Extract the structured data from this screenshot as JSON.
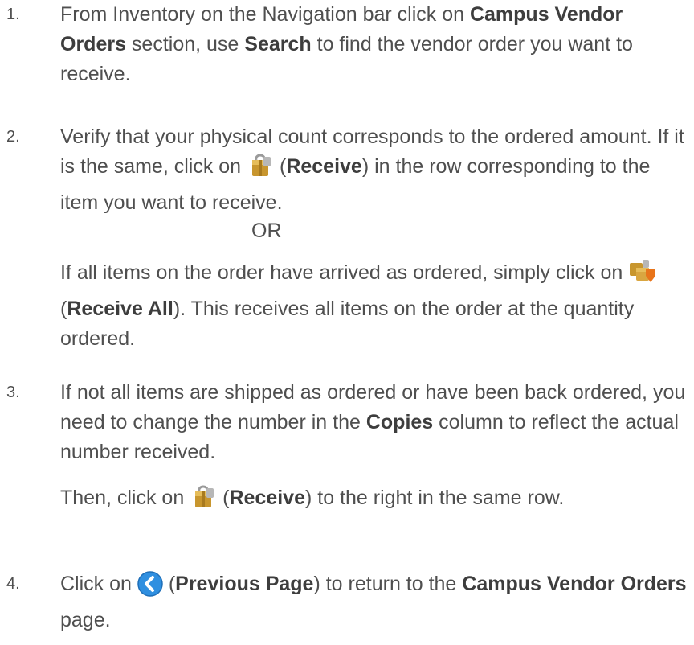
{
  "steps": [
    {
      "number": "1.",
      "text_a": "From Inventory on the Navigation bar click on ",
      "bold_a": "Campus Vendor Orders",
      "text_b": " section, use ",
      "bold_b": "Search",
      "text_c": " to find the vendor order you want to receive."
    },
    {
      "number": "2.",
      "text_a": "Verify that your physical count corresponds to the ordered amount. If it is the same, click on ",
      "icon_a": "receive-icon",
      "text_b": " (",
      "bold_b": "Receive",
      "text_c": ") in the row corresponding to the item you want to receive.",
      "or_label": "OR",
      "alt_text_a": "If all items on the order have arrived as ordered, simply click on ",
      "icon_b": "receive-all-icon",
      "alt_text_b": " (",
      "alt_bold": "Receive All",
      "alt_text_c": ").  This receives all items on the order at the quantity ordered."
    },
    {
      "number": "3.",
      "text_a": "If not all items are shipped as ordered or have been back ordered, you need to change the number in the ",
      "bold_a": "Copies",
      "text_b": " column to reflect the actual number received.",
      "then_text_a": "Then, click on ",
      "icon": "receive-icon",
      "then_text_b": " (",
      "then_bold": "Receive",
      "then_text_c": ") to the right in the same row."
    },
    {
      "number": "4.",
      "text_a": "Click on ",
      "icon": "previous-page-icon",
      "text_b": " (",
      "bold_b": "Previous Page",
      "text_c": ") to return to the ",
      "bold_c": "Campus Vendor Orders",
      "text_d": " page."
    }
  ],
  "colors": {
    "text": "#4f4f4f",
    "bold": "#3d3d3d",
    "previous_page_blue": "#2f8fe0",
    "package_gold": "#c8962e",
    "receive_all_orange": "#e8741a"
  }
}
